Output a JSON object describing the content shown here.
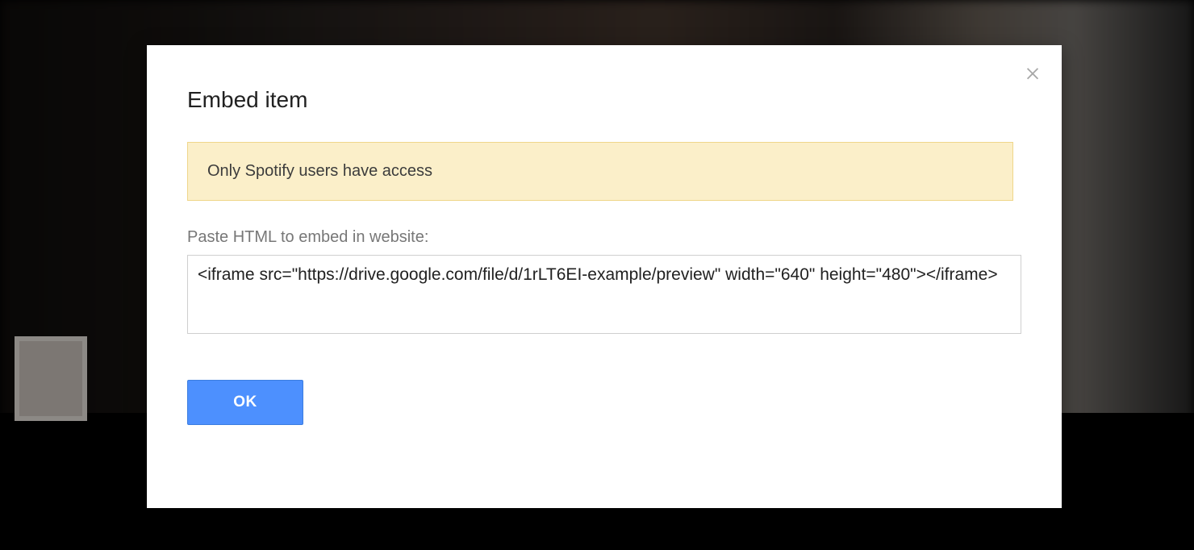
{
  "dialog": {
    "title": "Embed item",
    "warning_message": "Only Spotify users have access",
    "embed_label": "Paste HTML to embed in website:",
    "embed_code": "<iframe src=\"https://drive.google.com/file/d/1rLT6EI-example/preview\" width=\"640\" height=\"480\"></iframe>",
    "ok_label": "OK"
  }
}
